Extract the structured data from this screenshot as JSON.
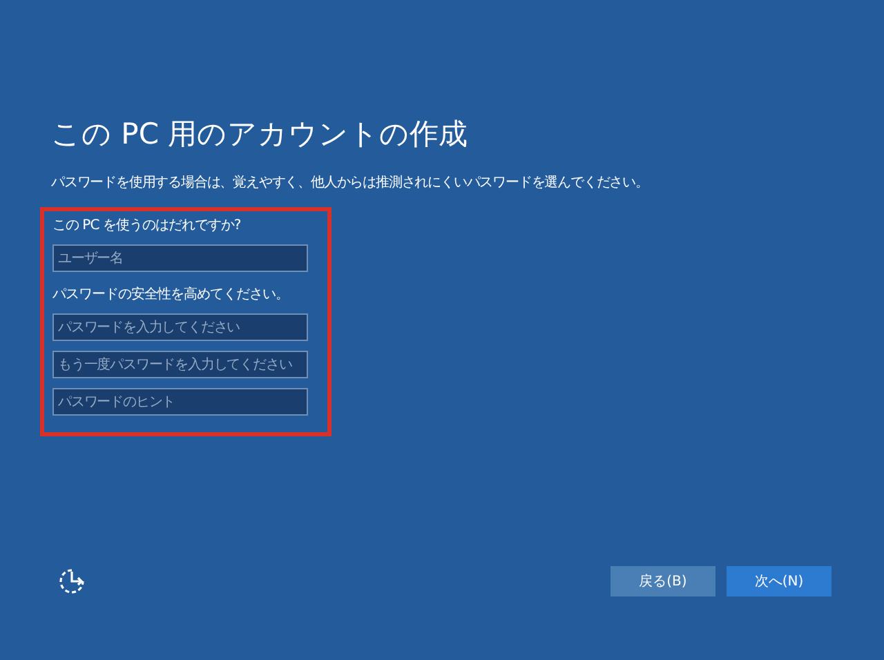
{
  "title": "この PC 用のアカウントの作成",
  "description": "パスワードを使用する場合は、覚えやすく、他人からは推測されにくいパスワードを選んでください。",
  "form": {
    "sections": [
      {
        "label": "この PC を使うのはだれですか?",
        "fields": [
          {
            "placeholder": "ユーザー名"
          }
        ]
      },
      {
        "label": "パスワードの安全性を高めてください。",
        "fields": [
          {
            "placeholder": "パスワードを入力してください"
          },
          {
            "placeholder": "もう一度パスワードを入力してください"
          },
          {
            "placeholder": "パスワードのヒント"
          }
        ]
      }
    ]
  },
  "buttons": [
    {
      "label": "戻る(B)",
      "kind": "secondary"
    },
    {
      "label": "次へ(N)",
      "kind": "primary"
    }
  ]
}
